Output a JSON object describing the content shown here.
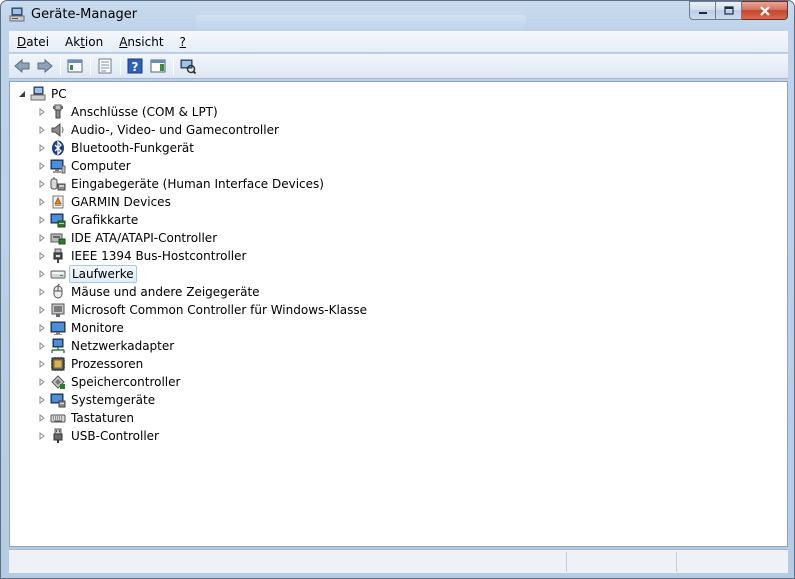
{
  "window": {
    "title": "Geräte-Manager",
    "icon": "device-manager-icon"
  },
  "caption_buttons": [
    "minimize",
    "maximize",
    "close"
  ],
  "menu": [
    {
      "label": "Datei",
      "underline": "D",
      "rest": "atei"
    },
    {
      "label": "Aktion",
      "pre": "Ak",
      "underline": "t",
      "rest": "ion"
    },
    {
      "label": "Ansicht",
      "underline": "A",
      "rest": "nsicht"
    },
    {
      "label": "?",
      "underline": "?",
      "rest": ""
    }
  ],
  "toolbar": [
    "back-icon",
    "forward-icon",
    "console-tree-icon",
    "properties-icon",
    "help-icon",
    "action-pane-icon",
    "scan-hardware-icon"
  ],
  "tree": {
    "root": {
      "label": "PC",
      "expanded": true
    },
    "items": [
      {
        "label": "Anschlüsse (COM & LPT)",
        "icon": "port-icon"
      },
      {
        "label": "Audio-, Video- und Gamecontroller",
        "icon": "speaker-icon"
      },
      {
        "label": "Bluetooth-Funkgerät",
        "icon": "bluetooth-icon"
      },
      {
        "label": "Computer",
        "icon": "computer-icon"
      },
      {
        "label": "Eingabegeräte (Human Interface Devices)",
        "icon": "hid-icon"
      },
      {
        "label": "GARMIN Devices",
        "icon": "garmin-icon"
      },
      {
        "label": "Grafikkarte",
        "icon": "display-adapter-icon"
      },
      {
        "label": "IDE ATA/ATAPI-Controller",
        "icon": "ide-controller-icon"
      },
      {
        "label": "IEEE 1394 Bus-Hostcontroller",
        "icon": "firewire-icon"
      },
      {
        "label": "Laufwerke",
        "icon": "disk-drive-icon",
        "selected": true
      },
      {
        "label": "Mäuse und andere Zeigegeräte",
        "icon": "mouse-icon"
      },
      {
        "label": "Microsoft Common Controller für Windows-Klasse",
        "icon": "common-controller-icon"
      },
      {
        "label": "Monitore",
        "icon": "monitor-icon"
      },
      {
        "label": "Netzwerkadapter",
        "icon": "network-adapter-icon"
      },
      {
        "label": "Prozessoren",
        "icon": "processor-icon"
      },
      {
        "label": "Speichercontroller",
        "icon": "storage-controller-icon"
      },
      {
        "label": "Systemgeräte",
        "icon": "system-devices-icon"
      },
      {
        "label": "Tastaturen",
        "icon": "keyboard-icon"
      },
      {
        "label": "USB-Controller",
        "icon": "usb-icon"
      }
    ]
  },
  "colors": {
    "selection_border": "#a6c8e8",
    "selection_fill": "#e1eefa",
    "frame": "#bfd3ea"
  }
}
